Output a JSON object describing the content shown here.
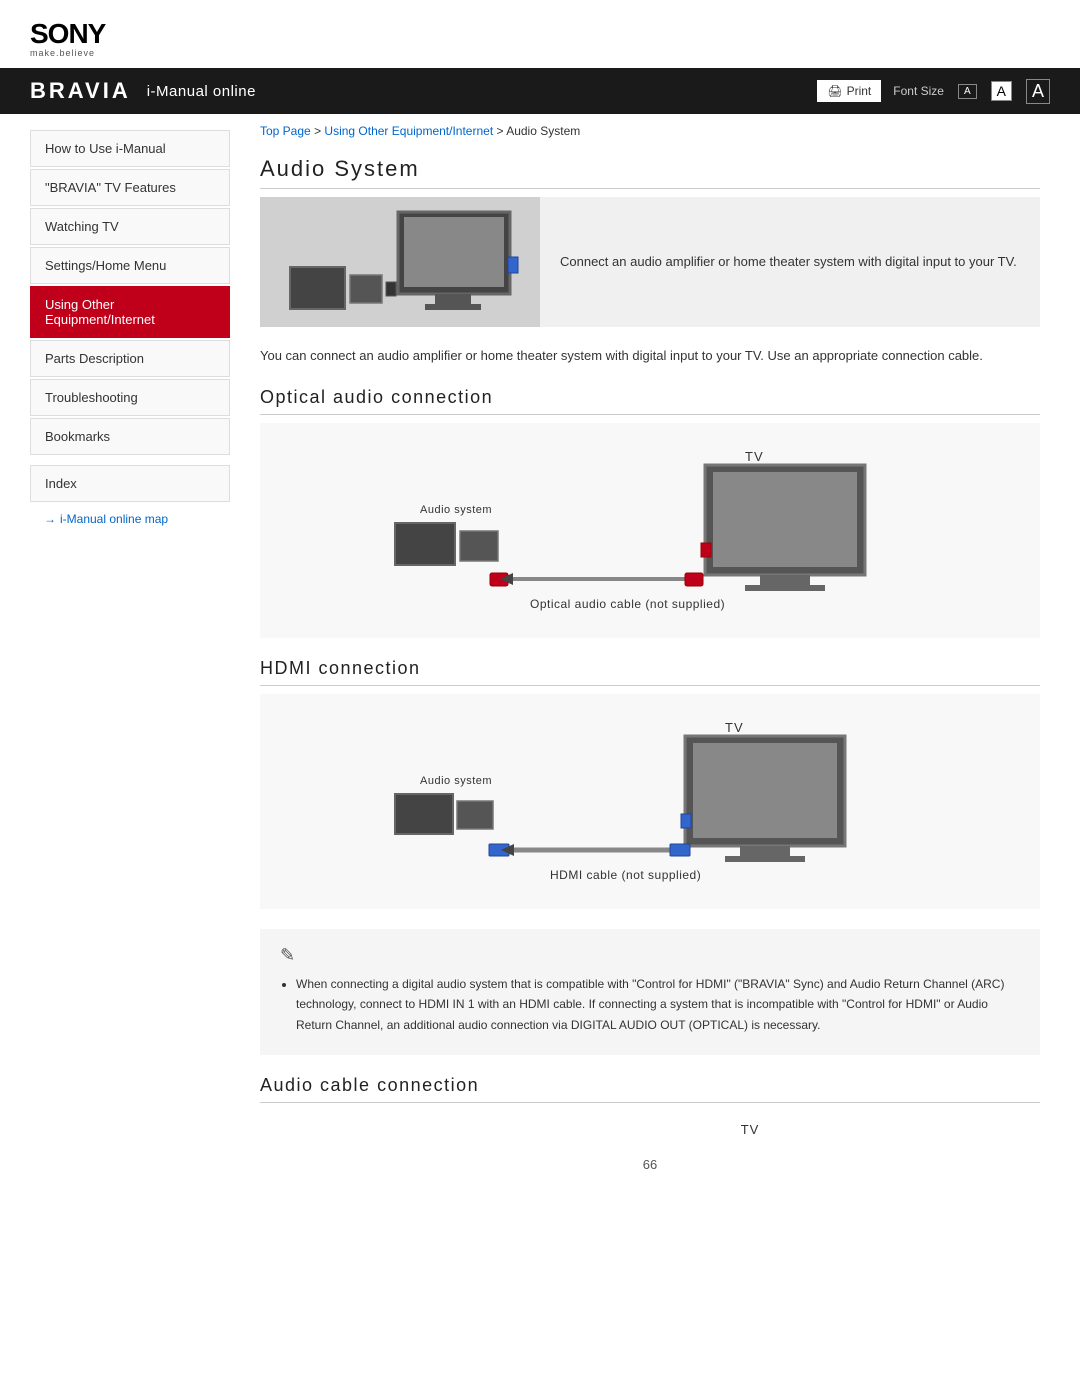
{
  "header": {
    "sony_logo": "SONY",
    "sony_tagline": "make.believe",
    "nav_title": "i-Manual online",
    "print_label": "Print",
    "font_size_label": "Font Size",
    "font_small": "A",
    "font_medium": "A",
    "font_large": "A"
  },
  "breadcrumb": {
    "top_page": "Top Page",
    "separator1": " > ",
    "using_other": "Using Other Equipment/Internet",
    "separator2": " > ",
    "current": "Audio System"
  },
  "sidebar": {
    "items": [
      {
        "label": "How to Use i-Manual",
        "active": false
      },
      {
        "label": "\"BRAVIA\" TV Features",
        "active": false
      },
      {
        "label": "Watching TV",
        "active": false
      },
      {
        "label": "Settings/Home Menu",
        "active": false
      },
      {
        "label": "Using Other Equipment/Internet",
        "active": true
      },
      {
        "label": "Parts Description",
        "active": false
      },
      {
        "label": "Troubleshooting",
        "active": false
      },
      {
        "label": "Bookmarks",
        "active": false
      }
    ],
    "index_label": "Index",
    "map_link": "i-Manual online map"
  },
  "main": {
    "page_title": "Audio System",
    "intro_image_alt": "TV with audio system",
    "intro_text": "Connect an audio amplifier or home theater system with digital input to your TV.",
    "intro_para": "You can connect an audio amplifier or home theater system with digital input to your TV. Use an appropriate connection cable.",
    "optical_section_title": "Optical audio connection",
    "optical_label_tv": "TV",
    "optical_label_audio": "Audio system",
    "optical_caption": "Optical audio cable (not supplied)",
    "hdmi_section_title": "HDMI connection",
    "hdmi_label_tv": "TV",
    "hdmi_label_audio": "Audio system",
    "hdmi_caption": "HDMI cable (not supplied)",
    "note_text": "When connecting a digital audio system that is compatible with \"Control for HDMI\" (\"BRAVIA\" Sync) and Audio Return Channel (ARC) technology, connect to HDMI IN 1 with an HDMI cable. If connecting a system that is incompatible with \"Control for HDMI\" or Audio Return Channel, an additional audio connection via DIGITAL AUDIO OUT (OPTICAL) is necessary.",
    "audio_cable_section_title": "Audio cable connection",
    "audio_cable_label_tv": "TV",
    "page_number": "66"
  }
}
